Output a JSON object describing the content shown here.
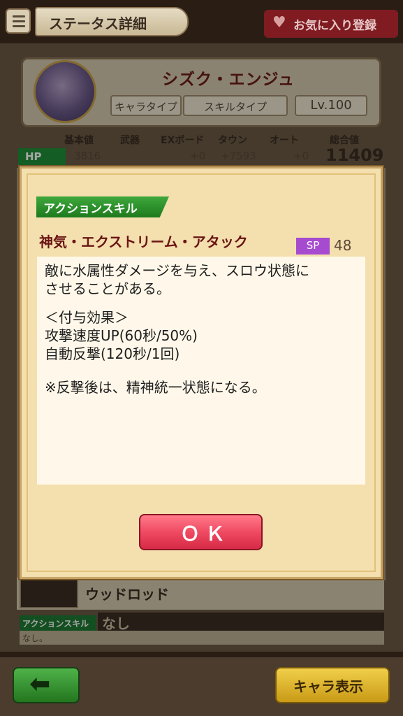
{
  "header": {
    "title": "ステータス詳細",
    "favorite_label": "お気に入り登録"
  },
  "character": {
    "name": "シズク・エンジュ",
    "chara_type_label": "キャラタイプ",
    "skill_type_label": "スキルタイプ",
    "level": "Lv.100"
  },
  "stats": {
    "headers": [
      "基本値",
      "武器",
      "EXボード",
      "タウン",
      "オート",
      "総合値"
    ],
    "hp": {
      "label": "HP",
      "base": "3816",
      "exboard": "+0",
      "town": "+7593",
      "auto": "+0",
      "total": "11409"
    }
  },
  "weapon": {
    "name": "ウッドロッド",
    "action_skill_label": "アクションスキル",
    "action_skill_value": "なし",
    "action_skill_desc": "なし。"
  },
  "modal": {
    "tag": "アクションスキル",
    "skill_name": "神気・エクストリーム・アタック",
    "sp_label": "SP",
    "sp_value": "48",
    "lines": [
      "敵に水属性ダメージを与え、スロウ状態に",
      "させることがある。",
      "＜付与効果＞",
      "攻撃速度UP(60秒/50%)",
      "自動反撃(120秒/1回)",
      "※反撃後は、精神統一状態になる。"
    ],
    "ok_label": "ＯＫ"
  },
  "footer": {
    "chara_button": "キャラ表示"
  },
  "icons": {
    "menu": "menu-icon",
    "heart": "heart-icon",
    "back": "back-arrow-icon"
  },
  "colors": {
    "accent_red": "#f04a62",
    "tag_green": "#1e7a1e",
    "sp_purple": "#a64bd0",
    "button_gold": "#f0cf4a"
  }
}
